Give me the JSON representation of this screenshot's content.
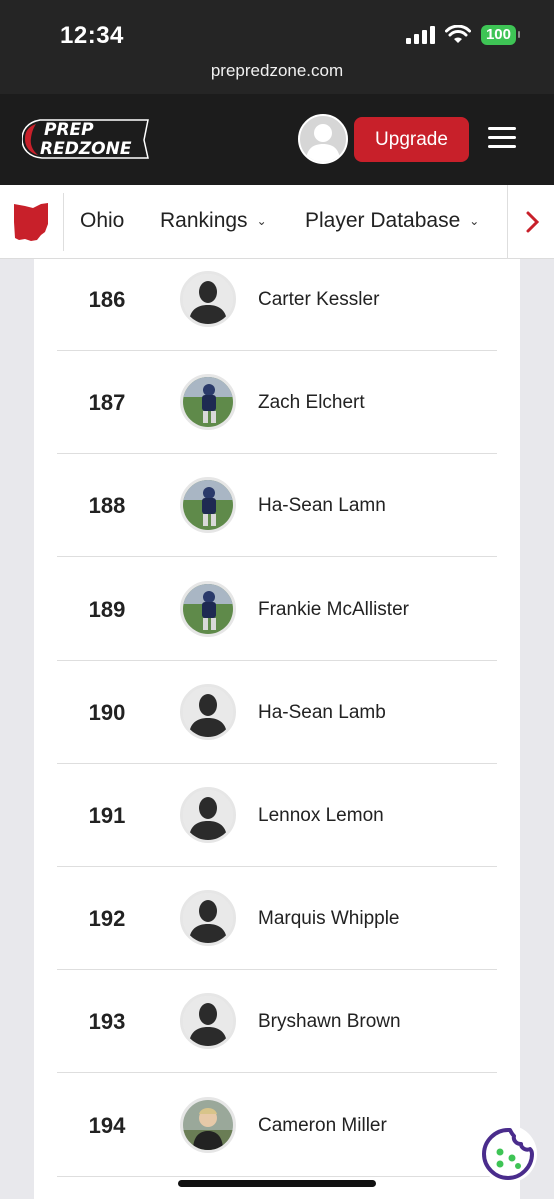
{
  "status": {
    "time": "12:34",
    "battery": "100"
  },
  "browser": {
    "url": "prepredzone.com"
  },
  "header": {
    "logo_top": "PREP",
    "logo_bottom": "REDZONE",
    "upgrade_label": "Upgrade"
  },
  "nav": {
    "state": "Ohio",
    "rankings": "Rankings",
    "player_database": "Player Database"
  },
  "colors": {
    "brand_red": "#c8202a",
    "header_bg": "#1c1c1c"
  },
  "players": [
    {
      "rank": "186",
      "name": "Carter Kessler",
      "photo": "placeholder"
    },
    {
      "rank": "187",
      "name": "Zach Elchert",
      "photo": "action"
    },
    {
      "rank": "188",
      "name": "Ha-Sean Lamn",
      "photo": "action"
    },
    {
      "rank": "189",
      "name": "Frankie McAllister",
      "photo": "action"
    },
    {
      "rank": "190",
      "name": "Ha-Sean Lamb",
      "photo": "placeholder"
    },
    {
      "rank": "191",
      "name": "Lennox Lemon",
      "photo": "placeholder"
    },
    {
      "rank": "192",
      "name": "Marquis Whipple",
      "photo": "placeholder"
    },
    {
      "rank": "193",
      "name": "Bryshawn Brown",
      "photo": "placeholder"
    },
    {
      "rank": "194",
      "name": "Cameron Miller",
      "photo": "portrait"
    }
  ]
}
